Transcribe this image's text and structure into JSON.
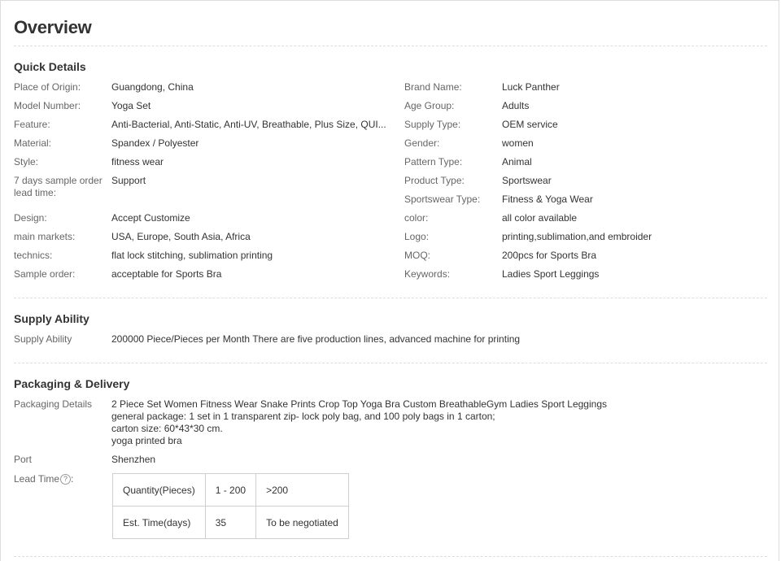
{
  "title": "Overview",
  "quick_details": {
    "heading": "Quick Details",
    "left": [
      {
        "label": "Place of Origin:",
        "value": "Guangdong, China"
      },
      {
        "label": "Model Number:",
        "value": "Yoga Set"
      },
      {
        "label": "Feature:",
        "value": "Anti-Bacterial, Anti-Static, Anti-UV, Breathable, Plus Size, QUI..."
      },
      {
        "label": "Material:",
        "value": "Spandex / Polyester"
      },
      {
        "label": "Style:",
        "value": "fitness wear"
      },
      {
        "label": "7 days sample order lead time:",
        "value": "Support"
      },
      {
        "label": "Design:",
        "value": "Accept Customize"
      },
      {
        "label": "main markets:",
        "value": "USA, Europe, South Asia, Africa"
      },
      {
        "label": "technics:",
        "value": "flat lock stitching, sublimation printing"
      },
      {
        "label": "Sample order:",
        "value": "acceptable for Sports Bra"
      }
    ],
    "right": [
      {
        "label": "Brand Name:",
        "value": "Luck Panther"
      },
      {
        "label": "Age Group:",
        "value": "Adults"
      },
      {
        "label": "Supply Type:",
        "value": "OEM service"
      },
      {
        "label": "Gender:",
        "value": "women"
      },
      {
        "label": "Pattern Type:",
        "value": "Animal"
      },
      {
        "label": "Product Type:",
        "value": "Sportswear"
      },
      {
        "label": "Sportswear Type:",
        "value": "Fitness & Yoga Wear"
      },
      {
        "label": "color:",
        "value": "all color available"
      },
      {
        "label": "Logo:",
        "value": "printing,sublimation,and embroider"
      },
      {
        "label": "MOQ:",
        "value": "200pcs for Sports Bra"
      },
      {
        "label": "Keywords:",
        "value": "Ladies Sport Leggings"
      }
    ]
  },
  "supply": {
    "heading": "Supply Ability",
    "label": "Supply Ability",
    "value": "200000 Piece/Pieces per Month There are five production lines, advanced machine for printing"
  },
  "packaging": {
    "heading": "Packaging & Delivery",
    "details_label": "Packaging Details",
    "details_lines": [
      "2 Piece Set Women Fitness Wear Snake Prints Crop Top Yoga Bra Custom BreathableGym Ladies Sport Leggings",
      "general package: 1 set in 1 transparent zip- lock poly bag, and 100 poly bags in 1 carton;",
      "carton size: 60*43*30 cm.",
      "yoga printed bra"
    ],
    "port_label": "Port",
    "port_value": "Shenzhen",
    "lead_label": "Lead Time",
    "lead_help": "?",
    "lead_colon": ":",
    "lead_table": {
      "row1": [
        "Quantity(Pieces)",
        "1 - 200",
        ">200"
      ],
      "row2": [
        "Est. Time(days)",
        "35",
        "To be negotiated"
      ]
    }
  }
}
